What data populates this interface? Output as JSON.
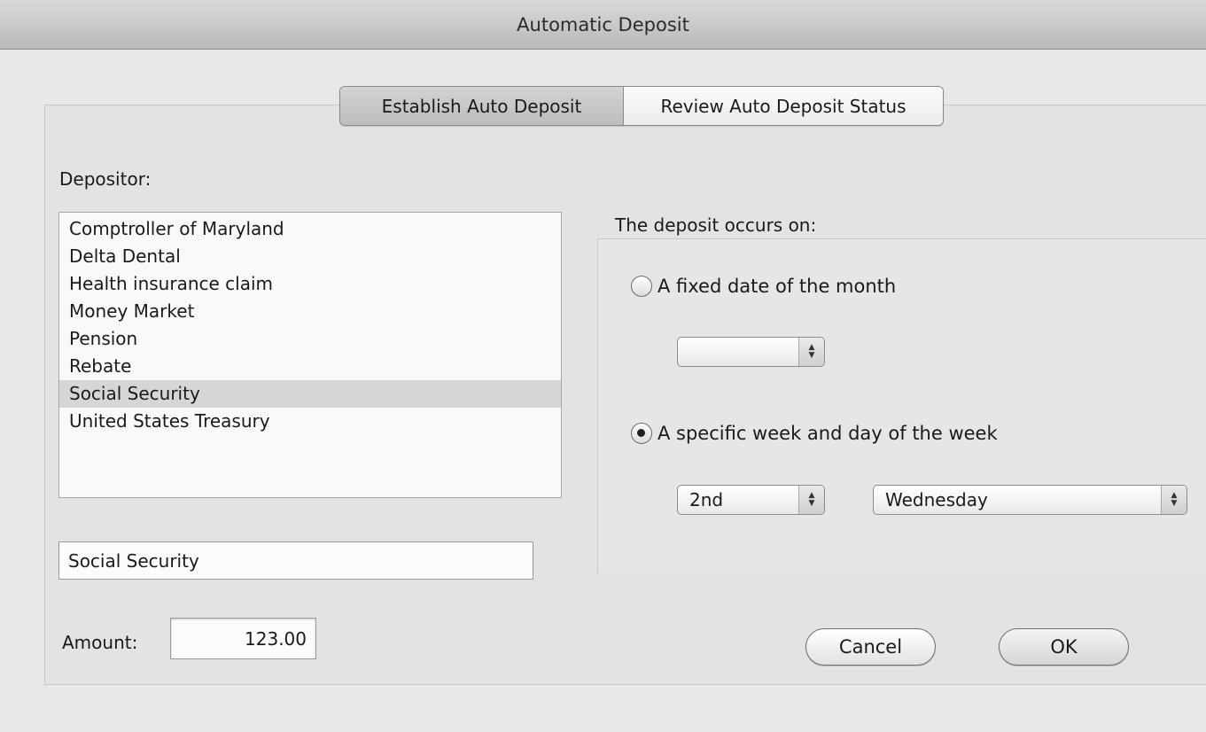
{
  "window": {
    "title": "Automatic Deposit"
  },
  "tabs": [
    {
      "label": "Establish Auto Deposit",
      "active": true
    },
    {
      "label": "Review Auto Deposit Status",
      "active": false
    }
  ],
  "depositor": {
    "label": "Depositor:",
    "items": [
      "Comptroller of Maryland",
      "Delta Dental",
      "Health insurance claim",
      "Money Market",
      "Pension",
      "Rebate",
      "Social Security",
      "United States Treasury"
    ],
    "selected": "Social Security",
    "field_value": "Social Security"
  },
  "amount": {
    "label": "Amount:",
    "value": "123.00"
  },
  "schedule": {
    "label": "The deposit occurs on:",
    "fixed_date_label": "A fixed date of the month",
    "fixed_date_checked": false,
    "fixed_date_value": "",
    "specific_week_label": "A specific week and day of the week",
    "specific_week_checked": true,
    "week_value": "2nd",
    "weekday_value": "Wednesday"
  },
  "buttons": {
    "cancel": "Cancel",
    "ok": "OK"
  },
  "icons": {
    "popup_arrows": "up-down-arrows-icon"
  }
}
